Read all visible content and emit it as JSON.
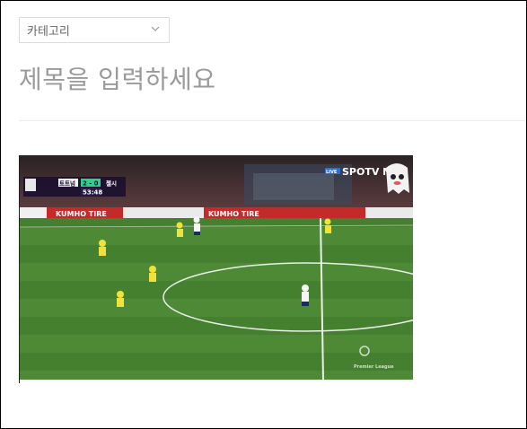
{
  "editor": {
    "category": {
      "label": "카테고리"
    },
    "title_placeholder": "제목을 입력하세요"
  },
  "video": {
    "scoreboard": {
      "home_team": "토트넘",
      "away_team": "첼시",
      "score": "2 - 0",
      "clock": "53:48"
    },
    "broadcaster": "SPOTV N",
    "live_badge": "LIVE",
    "ad_board_text": "KUMHO TIRE",
    "watermark": "Premier League"
  }
}
